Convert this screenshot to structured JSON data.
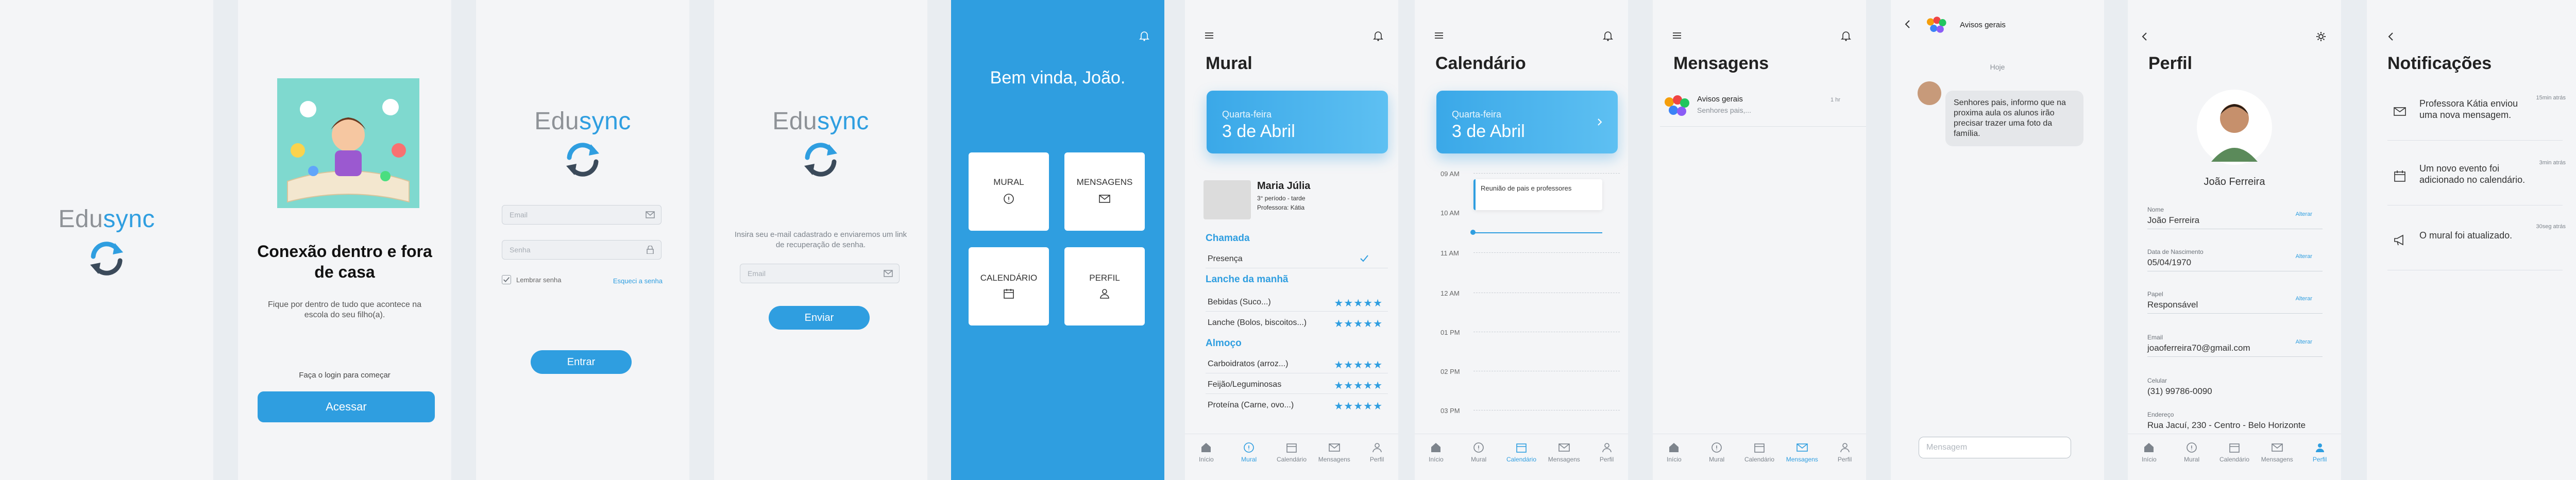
{
  "brand": {
    "part1": "Edu",
    "part2": "sync"
  },
  "onboarding": {
    "heading": "Conexão dentro e fora de casa",
    "subtext": "Fique por dentro de tudo que acontece na escola do seu filho(a).",
    "login_prompt": "Faça o login para começar",
    "access_button": "Acessar"
  },
  "login": {
    "email_placeholder": "Email",
    "password_placeholder": "Senha",
    "remember_label": "Lembrar senha",
    "forgot_link": "Esqueci a senha",
    "enter_button": "Entrar"
  },
  "recover": {
    "info": "Insira seu e-mail cadastrado e enviaremos um link de recuperação de senha.",
    "email_placeholder": "Email",
    "send_button": "Enviar"
  },
  "welcome": {
    "greeting": "Bem vinda, João.",
    "tiles": [
      {
        "label": "MURAL",
        "icon": "info-circle-icon"
      },
      {
        "label": "MENSAGENS",
        "icon": "mail-icon"
      },
      {
        "label": "CALENDÁRIO",
        "icon": "calendar-icon"
      },
      {
        "label": "PERFIL",
        "icon": "user-icon"
      }
    ]
  },
  "tabs": [
    "Início",
    "Mural",
    "Calendário",
    "Mensagens",
    "Perfil"
  ],
  "mural": {
    "title": "Mural",
    "weekday": "Quarta-feira",
    "date": "3 de Abril",
    "student": {
      "name": "Maria Júlia",
      "class": "3° período - tarde",
      "teacher": "Professora: Kátia"
    },
    "chamada_title": "Chamada",
    "presence": "Presença",
    "lanche_title": "Lanche da manhã",
    "lanche_items": [
      "Bebidas (Suco...)",
      "Lanche (Bolos, biscoitos...)"
    ],
    "almoco_title": "Almoço",
    "almoco_items": [
      "Carboidratos (arroz...)",
      "Feijão/Leguminosas",
      "Proteína (Carne, ovo...)"
    ],
    "stars": "★★★★★"
  },
  "calendar": {
    "title": "Calendário",
    "weekday": "Quarta-feira",
    "date": "3 de Abril",
    "hours": [
      "09 AM",
      "10 AM",
      "11 AM",
      "12 AM",
      "01 PM",
      "02 PM",
      "03 PM"
    ],
    "event": "Reunião de pais e professores"
  },
  "messages": {
    "title": "Mensagens",
    "item_title": "Avisos gerais",
    "item_preview": "Senhores pais,...",
    "item_time": "1 hr"
  },
  "chat": {
    "title": "Avisos gerais",
    "day": "Hoje",
    "message": "Senhores pais, informo que na proxima aula os alunos irão precisar trazer uma foto da família.",
    "input_placeholder": "Mensagem"
  },
  "profile": {
    "title": "Perfil",
    "name": "João Ferreira",
    "edit_label": "Alterar",
    "fields": [
      {
        "label": "Nome",
        "value": "João Ferreira",
        "editable": true
      },
      {
        "label": "Data de Nascimento",
        "value": "05/04/1970",
        "editable": true
      },
      {
        "label": "Papel",
        "value": "Responsável",
        "editable": true
      },
      {
        "label": "Email",
        "value": "joaoferreira70@gmail.com",
        "editable": true
      },
      {
        "label": "Celular",
        "value": "(31) 99786-0090",
        "editable": false
      },
      {
        "label": "Endereço",
        "value": "Rua Jacuí, 230 - Centro - Belo Horizonte",
        "editable": false
      }
    ]
  },
  "notifications": {
    "title": "Notificações",
    "items": [
      {
        "text": "Professora Kátia enviou uma nova mensagem.",
        "time": "15min atrás",
        "icon": "mail-icon"
      },
      {
        "text": "Um novo evento foi adicionado no calendário.",
        "time": "3min atrás",
        "icon": "calendar-icon"
      },
      {
        "text": "O mural foi atualizado.",
        "time": "30seg atrás",
        "icon": "megaphone-icon"
      }
    ]
  },
  "colors": {
    "accent": "#2f9ee0",
    "background": "#f4f5f7"
  }
}
